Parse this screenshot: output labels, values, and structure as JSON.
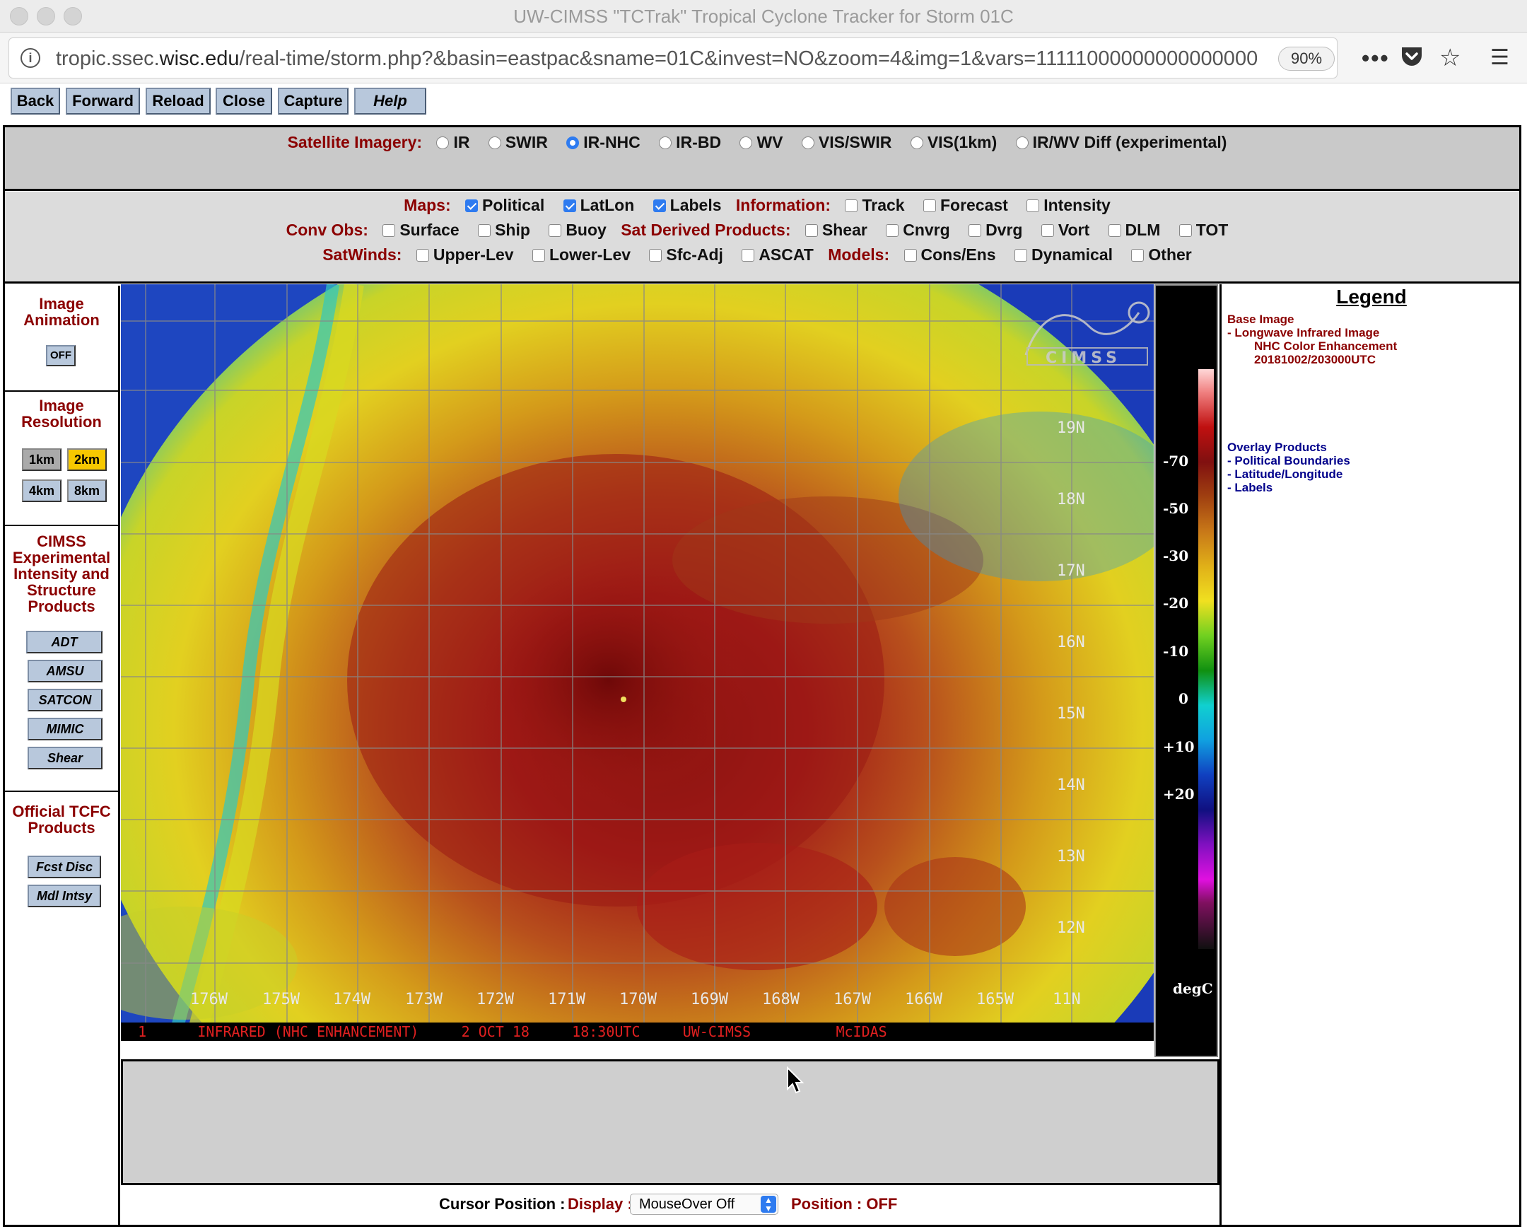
{
  "window": {
    "title": "UW-CIMSS \"TCTrak\" Tropical Cyclone Tracker for Storm 01C"
  },
  "urlbar": {
    "url_prefix": "tropic.ssec.",
    "url_domain": "wisc.edu",
    "url_suffix": "/real-time/storm.php?&basin=eastpac&sname=01C&invest=NO&zoom=4&img=1&vars=111110000000000000000",
    "zoom": "90%"
  },
  "nav_buttons": [
    "Back",
    "Forward",
    "Reload",
    "Close",
    "Capture",
    "Help"
  ],
  "satellite_imagery": {
    "label": "Satellite Imagery:",
    "options": [
      {
        "label": "IR",
        "selected": false
      },
      {
        "label": "SWIR",
        "selected": false
      },
      {
        "label": "IR-NHC",
        "selected": true
      },
      {
        "label": "IR-BD",
        "selected": false
      },
      {
        "label": "WV",
        "selected": false
      },
      {
        "label": "VIS/SWIR",
        "selected": false
      },
      {
        "label": "VIS(1km)",
        "selected": false
      },
      {
        "label": "IR/WV Diff (experimental)",
        "selected": false
      }
    ]
  },
  "options": {
    "maps_label": "Maps:",
    "maps": [
      {
        "label": "Political",
        "checked": true
      },
      {
        "label": "LatLon",
        "checked": true
      },
      {
        "label": "Labels",
        "checked": true
      }
    ],
    "information_label": "Information:",
    "information": [
      {
        "label": "Track",
        "checked": false
      },
      {
        "label": "Forecast",
        "checked": false
      },
      {
        "label": "Intensity",
        "checked": false
      }
    ],
    "conv_obs_label": "Conv Obs:",
    "conv_obs": [
      {
        "label": "Surface",
        "checked": false
      },
      {
        "label": "Ship",
        "checked": false
      },
      {
        "label": "Buoy",
        "checked": false
      }
    ],
    "sat_derived_label": "Sat Derived Products:",
    "sat_derived": [
      {
        "label": "Shear",
        "checked": false
      },
      {
        "label": "Cnvrg",
        "checked": false
      },
      {
        "label": "Dvrg",
        "checked": false
      },
      {
        "label": "Vort",
        "checked": false
      },
      {
        "label": "DLM",
        "checked": false
      },
      {
        "label": "TOT",
        "checked": false
      }
    ],
    "satwinds_label": "SatWinds:",
    "satwinds": [
      {
        "label": "Upper-Lev",
        "checked": false
      },
      {
        "label": "Lower-Lev",
        "checked": false
      },
      {
        "label": "Sfc-Adj",
        "checked": false
      },
      {
        "label": "ASCAT",
        "checked": false
      }
    ],
    "models_label": "Models:",
    "models": [
      {
        "label": "Cons/Ens",
        "checked": false
      },
      {
        "label": "Dynamical",
        "checked": false
      },
      {
        "label": "Other",
        "checked": false
      }
    ]
  },
  "sidebar": {
    "animation_title": "Image Animation",
    "animation_button": "OFF",
    "resolution_title": "Image Resolution",
    "resolutions": [
      {
        "label": "1km",
        "active": false
      },
      {
        "label": "2km",
        "active": true
      },
      {
        "label": "4km",
        "active": false
      },
      {
        "label": "8km",
        "active": false
      }
    ],
    "cimss_title": "CIMSS Experimental Intensity and Structure Products",
    "cimss_buttons": [
      "ADT",
      "AMSU",
      "SATCON",
      "MIMIC",
      "Shear"
    ],
    "tcfc_title": "Official TCFC Products",
    "tcfc_buttons": [
      "Fcst Disc",
      "Mdl Intsy"
    ]
  },
  "image": {
    "lat_labels": [
      "19N",
      "18N",
      "17N",
      "16N",
      "15N",
      "14N",
      "13N",
      "12N",
      "11N"
    ],
    "lon_labels": [
      "176W",
      "175W",
      "174W",
      "173W",
      "172W",
      "171W",
      "170W",
      "169W",
      "168W",
      "167W",
      "166W",
      "165W"
    ],
    "logo_text": "CIMSS",
    "bottom_bar": "  1      INFRARED (NHC ENHANCEMENT)     2 OCT 18     18:30UTC     UW-CIMSS          McIDAS"
  },
  "colorbar": {
    "tick_labels": [
      "-70",
      "-50",
      "-30",
      "-20",
      "-10",
      "0",
      "+10",
      "+20"
    ],
    "unit": "degC"
  },
  "legend": {
    "title": "Legend",
    "base_image_title": "Base Image",
    "base_image_lines": [
      "-  Longwave Infrared Image",
      "NHC Color Enhancement",
      "20181002/203000UTC"
    ],
    "overlay_title": "Overlay Products",
    "overlay_lines": [
      "-  Political Boundaries",
      "-  Latitude/Longitude",
      "-  Labels"
    ],
    "colors": {
      "red": "#8b0000",
      "blue": "#00008b"
    }
  },
  "cursor": {
    "label": "Cursor Position :",
    "display_label": "Display :",
    "display_value": "MouseOver Off",
    "position_label": "Position : OFF"
  }
}
